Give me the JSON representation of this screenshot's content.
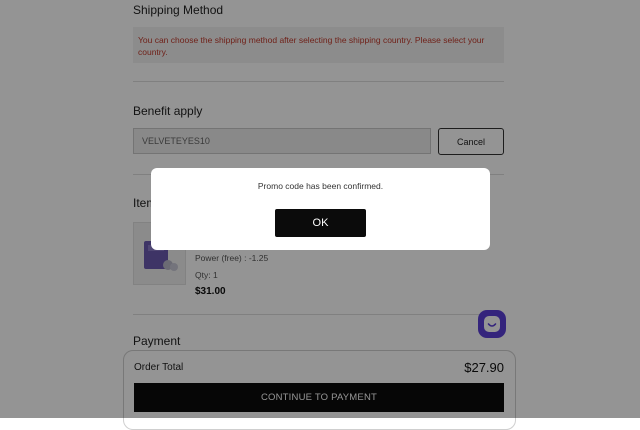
{
  "shipping": {
    "title": "Shipping Method",
    "notice": "You can choose the shipping method after selecting the shipping country. Please select your country."
  },
  "benefit": {
    "title": "Benefit apply",
    "promo_value": "VELVETEYES10",
    "cancel_label": "Cancel"
  },
  "items": {
    "title": "Item",
    "list": [
      {
        "power": "Power (free) : -1.25",
        "qty": "Qty: 1",
        "price": "$31.00"
      }
    ]
  },
  "payment": {
    "title": "Payment",
    "order_total_label": "Order Total",
    "order_total_value": "$27.90",
    "continue_label": "CONTINUE TO PAYMENT"
  },
  "modal": {
    "message": "Promo code has been confirmed.",
    "ok_label": "OK"
  },
  "colors": {
    "notice_text": "#c0392b",
    "chat_button": "#5b3fd6",
    "primary_button": "#0b0b0b"
  },
  "icons": {
    "chat": "chat-smile-icon",
    "item_image": "lens-product-image"
  }
}
